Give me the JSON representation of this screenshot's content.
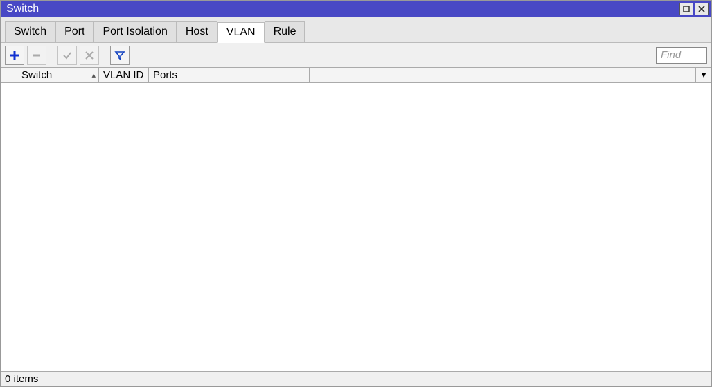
{
  "window": {
    "title": "Switch"
  },
  "tabs": [
    {
      "label": "Switch"
    },
    {
      "label": "Port"
    },
    {
      "label": "Port Isolation"
    },
    {
      "label": "Host"
    },
    {
      "label": "VLAN"
    },
    {
      "label": "Rule"
    }
  ],
  "active_tab_index": 4,
  "toolbar": {
    "icons": {
      "add": "plus-icon",
      "remove": "minus-icon",
      "enable": "check-icon",
      "disable": "x-icon",
      "filter": "funnel-icon"
    }
  },
  "find": {
    "placeholder": "Find"
  },
  "columns": {
    "switch": "Switch",
    "vlan_id": "VLAN ID",
    "ports": "Ports"
  },
  "sort_indicator": "▴",
  "column_menu_glyph": "▼",
  "rows": [],
  "status": {
    "items_label": "0 items"
  }
}
